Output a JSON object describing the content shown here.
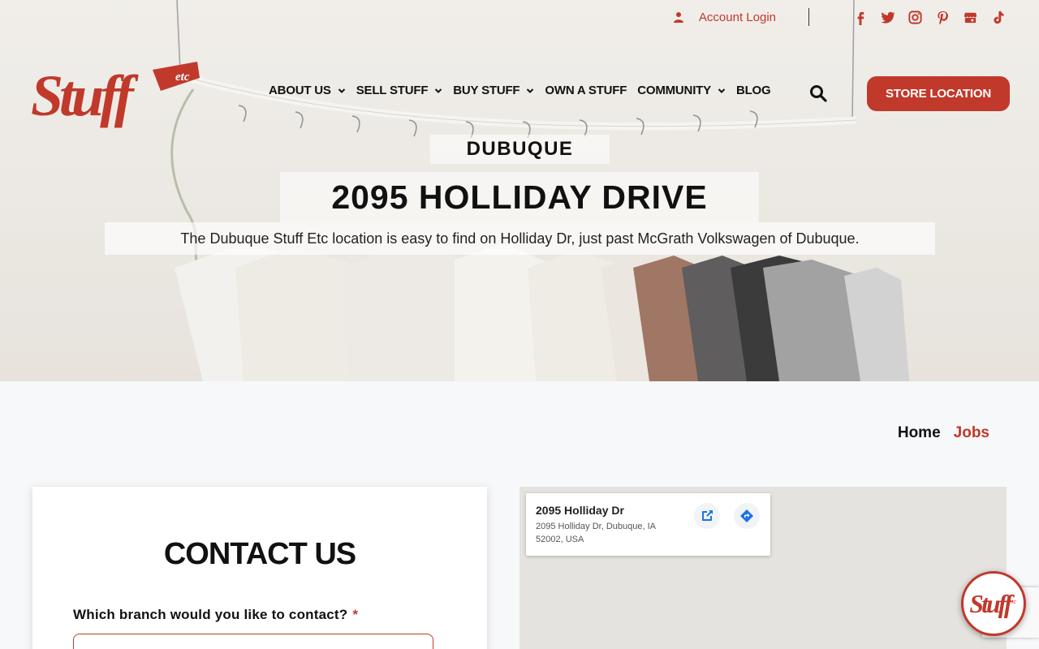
{
  "topbar": {
    "account_label": "Account Login",
    "social_icons": [
      "facebook-icon",
      "twitter-icon",
      "instagram-icon",
      "pinterest-icon",
      "google-business-icon",
      "tiktok-icon"
    ]
  },
  "brand": {
    "logo_text": "Stuff",
    "logo_suffix": "etc",
    "accent_color": "#c0392b"
  },
  "nav": {
    "items": [
      {
        "label": "ABOUT US",
        "has_dropdown": true
      },
      {
        "label": "SELL STUFF",
        "has_dropdown": true
      },
      {
        "label": "BUY STUFF",
        "has_dropdown": true
      },
      {
        "label": "OWN A STUFF",
        "has_dropdown": false
      },
      {
        "label": "COMMUNITY",
        "has_dropdown": true
      },
      {
        "label": "BLOG",
        "has_dropdown": false
      }
    ],
    "store_button": "STORE LOCATION"
  },
  "hero": {
    "subtitle": "DUBUQUE",
    "title": "2095 HOLLIDAY DRIVE",
    "description": "The Dubuque Stuff Etc location is easy to find on Holliday Dr, just past McGrath Volkswagen of Dubuque."
  },
  "breadcrumb": {
    "home": "Home",
    "current": "Jobs"
  },
  "contact": {
    "title": "CONTACT US",
    "branch_label": "Which branch would you like to contact?",
    "required_mark": "*"
  },
  "map": {
    "place_name": "2095 Holliday Dr",
    "address": "2095 Holliday Dr, Dubuque, IA 52002, USA"
  }
}
